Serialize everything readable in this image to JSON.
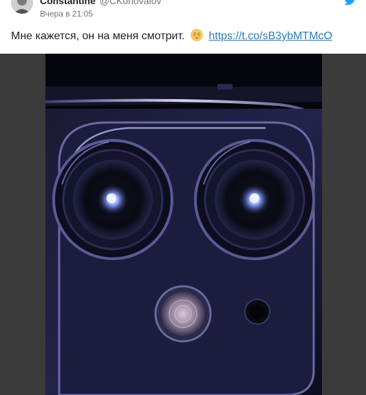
{
  "tweet": {
    "display_name": "Constantine",
    "handle": "@CKonovalov",
    "timestamp": "Вчера в 21:05",
    "text": "Мне кажется, он на меня смотрит.",
    "emoji": "flushed-face-emoji",
    "link": "https://t.co/sB3ybMTMcO"
  },
  "icons": {
    "brand": "twitter-bird-icon"
  },
  "colors": {
    "link": "#2b7bb9",
    "twitter_blue": "#1da1f2",
    "media_background": "#3b3b3b"
  }
}
